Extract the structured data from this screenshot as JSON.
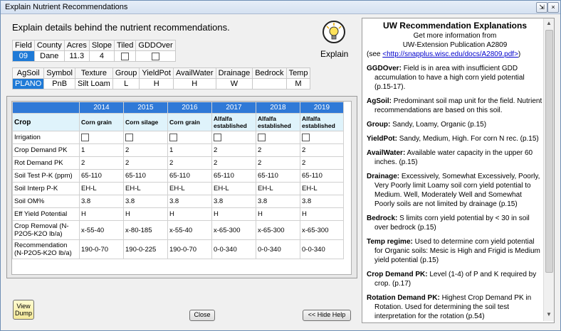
{
  "window": {
    "title": "Explain Nutrient Recommendations"
  },
  "heading": "Explain details behind the nutrient recommendations.",
  "explain_label": "Explain",
  "field_table": {
    "headers": [
      "Field",
      "County",
      "Acres",
      "Slope",
      "Tiled",
      "GDDOver"
    ],
    "values": [
      "09",
      "Dane",
      "11.3",
      "4",
      "",
      ""
    ]
  },
  "soil_table": {
    "headers": [
      "AgSoil",
      "Symbol",
      "Texture",
      "Group",
      "YieldPot",
      "AvailWater",
      "Drainage",
      "Bedrock",
      "Temp"
    ],
    "values": [
      "PLANO",
      "PnB",
      "Silt Loam",
      "L",
      "H",
      "H",
      "W",
      "",
      "M"
    ]
  },
  "crop_table": {
    "years": [
      "2014",
      "2015",
      "2016",
      "2017",
      "2018",
      "2019"
    ],
    "crop_label": "Crop",
    "crops": [
      "Corn grain",
      "Corn silage",
      "Corn grain",
      "Alfalfa established",
      "Alfalfa established",
      "Alfalfa established"
    ],
    "rows": [
      {
        "label": "Irrigation",
        "values": [
          "",
          "",
          "",
          "",
          "",
          ""
        ]
      },
      {
        "label": "Crop Demand PK",
        "values": [
          "1",
          "2",
          "1",
          "2",
          "2",
          "2"
        ]
      },
      {
        "label": "Rot Demand PK",
        "values": [
          "2",
          "2",
          "2",
          "2",
          "2",
          "2"
        ]
      },
      {
        "label": "Soil Test P-K (ppm)",
        "values": [
          "65-110",
          "65-110",
          "65-110",
          "65-110",
          "65-110",
          "65-110"
        ]
      },
      {
        "label": "Soil Interp P-K",
        "values": [
          "EH-L",
          "EH-L",
          "EH-L",
          "EH-L",
          "EH-L",
          "EH-L"
        ]
      },
      {
        "label": "Soil OM%",
        "values": [
          "3.8",
          "3.8",
          "3.8",
          "3.8",
          "3.8",
          "3.8"
        ]
      },
      {
        "label": "Eff Yield Potential",
        "values": [
          "H",
          "H",
          "H",
          "H",
          "H",
          "H"
        ]
      },
      {
        "label": "Crop Removal (N-P2O5-K2O lb/a)",
        "values": [
          "x-55-40",
          "x-80-185",
          "x-55-40",
          "x-65-300",
          "x-65-300",
          "x-65-300"
        ]
      },
      {
        "label": "Recommendation (N-P2O5-K2O lb/a)",
        "values": [
          "190-0-70",
          "190-0-225",
          "190-0-70",
          "0-0-340",
          "0-0-340",
          "0-0-340"
        ]
      }
    ]
  },
  "buttons": {
    "view_dump": "View Dump",
    "close": "Close",
    "hide_help": "<< Hide Help"
  },
  "help": {
    "title": "UW Recommendation Explanations",
    "line1": "Get more information from",
    "line2": "UW-Extension Publication A2809",
    "see_prefix": "(see ",
    "link": "<http://snapplus.wisc.edu/docs/A2809.pdf>",
    "see_suffix": ")",
    "entries": [
      {
        "term": "GGDOver:",
        "text": "Field is in area with insufficient GDD accumulation to have a high corn yield potential (p.15-17)."
      },
      {
        "term": "AgSoil:",
        "text": "Predominant soil map unit for the field.  Nutrient recommendations are based on this soil."
      },
      {
        "term": "Group:",
        "text": "Sandy, Loamy, Organic (p.15)"
      },
      {
        "term": "YieldPot:",
        "text": "Sandy, Medium, High.  For corn N rec.  (p.15)"
      },
      {
        "term": "AvailWater:",
        "text": "Available water capacity in the upper 60 inches. (p.15)"
      },
      {
        "term": "Drainage:",
        "text": "Excessively, Somewhat Excessively, Poorly, Very Poorly limit Loamy soil corn yield potential to Medium.  Well, Moderately Well and Somewhat Poorly soils are not limited by drainage (p.15)"
      },
      {
        "term": "Bedrock:",
        "text": "S limits corn yield potential by < 30 in soil over bedrock (p.15)"
      },
      {
        "term": "Temp regime:",
        "text": "Used to determine corn yield potential for Organic soils:  Mesic is High and Frigid is Medium yield potential (p.15)"
      },
      {
        "term": "Crop Demand PK:",
        "text": "Level (1-4) of P and K required by crop. (p.17)"
      },
      {
        "term": "Rotation Demand PK:",
        "text": "Highest Crop Demand PK in Rotation.  Used for determining the soil test interpretation for the rotation (p.54)"
      }
    ]
  },
  "colors": {
    "accent": "#1e7ad7",
    "year_header": "#2f79d7",
    "crop_header": "#dff3fb",
    "button_yellow": "#fff9c4"
  }
}
